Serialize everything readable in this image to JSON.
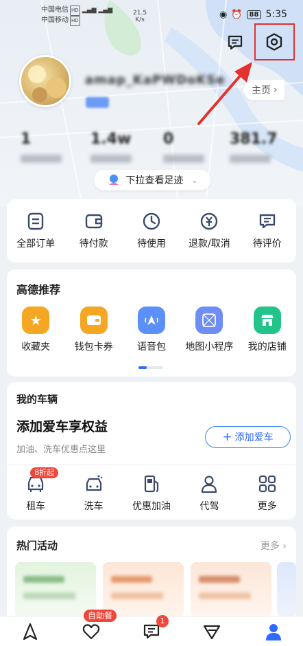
{
  "status_bar": {
    "carrier1": "中国电信",
    "carrier2": "中国移动",
    "hd": "HD",
    "net_speed": "21.5",
    "net_unit": "K/s",
    "battery": "88",
    "time": "5:35"
  },
  "header": {
    "username": "amap_KaPWDoKSe",
    "home_label": "主页",
    "stats": [
      {
        "value": "1",
        "label": "--"
      },
      {
        "value": "1.4w",
        "label": "--"
      },
      {
        "value": "0",
        "label": "--"
      },
      {
        "value": "381.7",
        "label": "--"
      }
    ],
    "pull_label": "下拉查看足迹"
  },
  "orders": {
    "items": [
      {
        "label": "全部订单",
        "icon": "order-list-icon"
      },
      {
        "label": "待付款",
        "icon": "wallet-icon"
      },
      {
        "label": "待使用",
        "icon": "clock-icon"
      },
      {
        "label": "退款/取消",
        "icon": "yuan-refund-icon"
      },
      {
        "label": "待评价",
        "icon": "comment-icon"
      }
    ]
  },
  "recommend": {
    "title": "高德推荐",
    "items": [
      {
        "label": "收藏夹",
        "icon": "star-icon",
        "color": "#f5a623"
      },
      {
        "label": "钱包卡券",
        "icon": "wallet-card-icon",
        "color": "#f5a623"
      },
      {
        "label": "语音包",
        "icon": "voice-icon",
        "color": "#5b8ff9"
      },
      {
        "label": "地图小程序",
        "icon": "mini-program-icon",
        "color": "#6f8ef5"
      },
      {
        "label": "我的店铺",
        "icon": "shop-icon",
        "color": "#23c48a"
      }
    ]
  },
  "vehicle": {
    "title": "我的车辆",
    "headline": "添加爱车享权益",
    "subtitle": "加油、洗车优惠点这里",
    "add_button": "添加爱车",
    "services": [
      {
        "label": "租车",
        "icon": "rent-car-icon",
        "badge": "8折起"
      },
      {
        "label": "洗车",
        "icon": "car-wash-icon"
      },
      {
        "label": "优惠加油",
        "icon": "fuel-pump-icon"
      },
      {
        "label": "代驾",
        "icon": "driver-icon"
      },
      {
        "label": "更多",
        "icon": "grid-more-icon"
      }
    ]
  },
  "activities": {
    "title": "热门活动",
    "more": "更多"
  },
  "tabbar": {
    "self_service_badge": "自助餐",
    "message_badge": "1"
  },
  "colors": {
    "accent": "#2f6bff",
    "highlight_box": "#e4312f",
    "icon_stroke": "#3a4a6b"
  }
}
